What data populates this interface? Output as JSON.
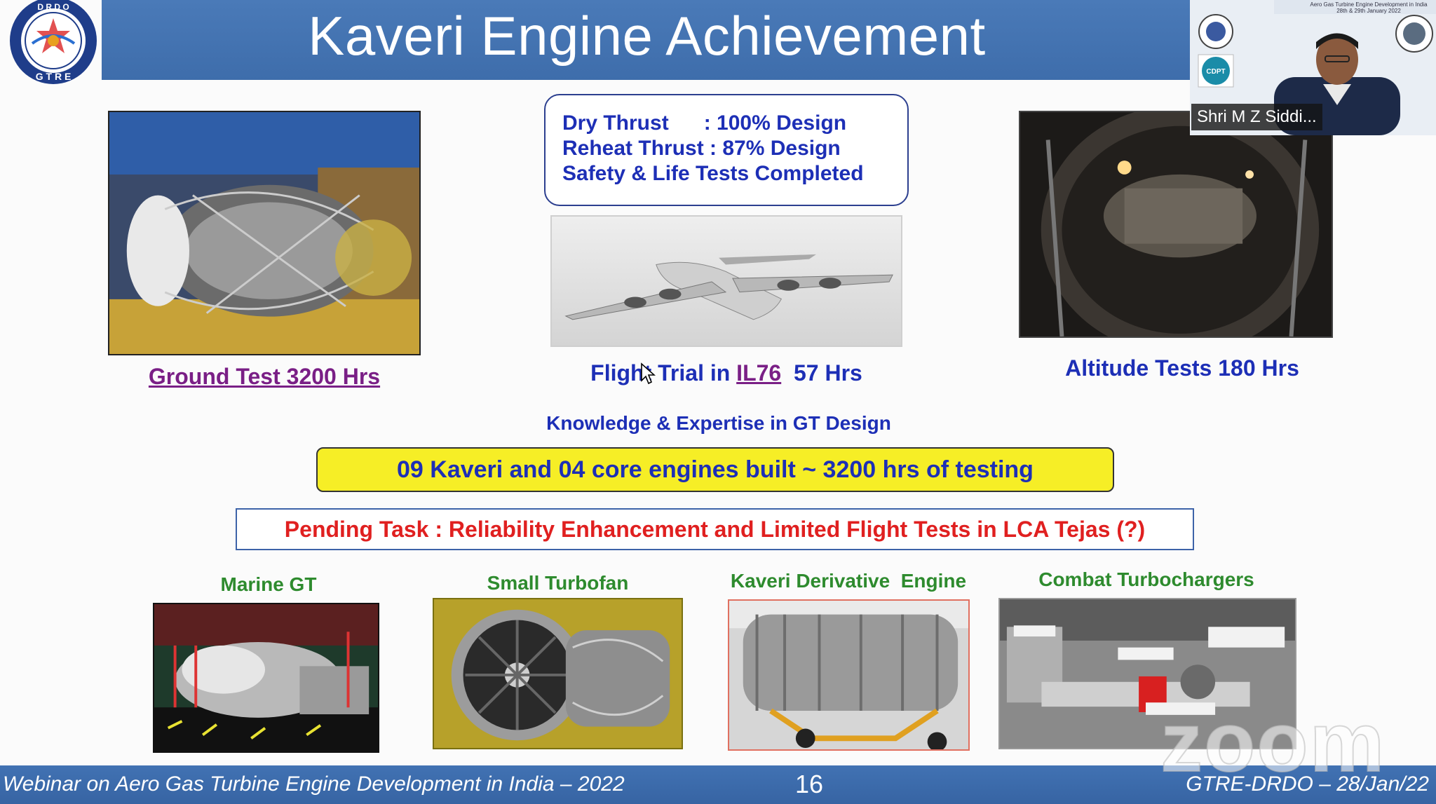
{
  "slide": {
    "title": "Kaveri Engine Achievement",
    "logo_text_top": "D R D O",
    "logo_text_bottom": "G T R E",
    "specs": [
      "Dry Thrust      : 100% Design",
      "Reheat Thrust : 87% Design",
      "Safety & Life Tests Completed"
    ],
    "ground_test_caption": "Ground Test 3200 Hrs",
    "flight_trial_prefix": "Flight Trial in ",
    "flight_trial_link": "IL76",
    "flight_trial_suffix": "  57 Hrs",
    "altitude_caption": "Altitude Tests 180 Hrs",
    "knowledge_caption": "Knowledge & Expertise  in GT Design",
    "engines_built_banner": "09 Kaveri and 04 core engines built  ~ 3200 hrs of testing",
    "pending_task": "Pending Task : Reliability Enhancement and Limited Flight Tests in LCA Tejas (?)",
    "derivatives": [
      {
        "label": "Marine GT"
      },
      {
        "label": "Small Turbofan"
      },
      {
        "label": "Kaveri Derivative  Engine"
      },
      {
        "label": "Combat Turbochargers"
      }
    ],
    "footer_left": "Webinar on Aero Gas Turbine Engine Development in India  – 2022",
    "page_number": "16",
    "footer_right": "GTRE-DRDO – 28/Jan/22"
  },
  "zoom": {
    "speaker_name": "Shri M Z Siddi...",
    "badge_text": "CDPT",
    "banner_line1": "Aero Gas Turbine Engine Development in India",
    "banner_line2": "28th & 29th January 2022",
    "watermark": "zoom"
  },
  "colors": {
    "header_blue": "#3e6dab",
    "caption_blue": "#1d2fb6",
    "caption_green": "#2e8b2e",
    "pending_red": "#e02020",
    "banner_yellow": "#f6ee26"
  }
}
